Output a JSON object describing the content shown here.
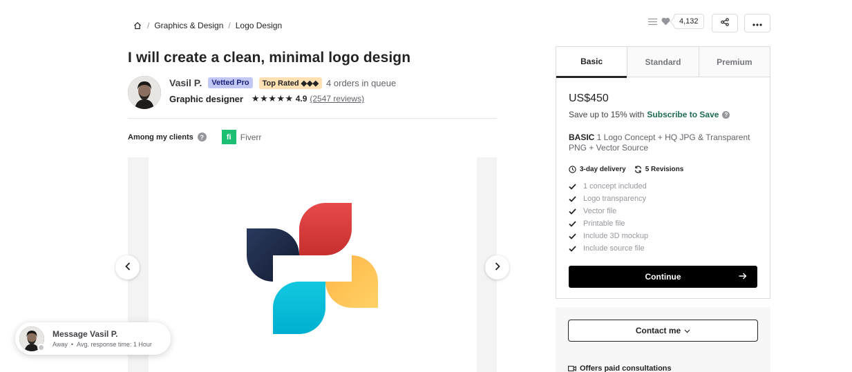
{
  "breadcrumb": {
    "items": [
      "Graphics & Design",
      "Logo Design"
    ],
    "separator": "/"
  },
  "header": {
    "likes_count": "4,132"
  },
  "gig": {
    "title": "I will create a clean, minimal logo design"
  },
  "seller": {
    "name": "Vasil P.",
    "badge_vetted": "Vetted Pro",
    "badge_top": "Top Rated ◆◆◆",
    "queue": "4 orders in queue",
    "job_title": "Graphic designer",
    "stars": "★★★★★",
    "rating": "4.9",
    "reviews": "(2547 reviews)"
  },
  "clients": {
    "label": "Among my clients",
    "client_name": "Fiverr",
    "client_logo_text": "fi"
  },
  "package": {
    "tabs": [
      "Basic",
      "Standard",
      "Premium"
    ],
    "active_tab": "Basic",
    "price": "US$450",
    "save_prefix": "Save up to 15% with",
    "save_link": "Subscribe to Save",
    "desc_title": "BASIC",
    "desc_text": " 1 Logo Concept + HQ JPG & Transparent PNG + Vector Source",
    "delivery": "3-day delivery",
    "revisions": "5 Revisions",
    "features": [
      "1 concept included",
      "Logo transparency",
      "Vector file",
      "Printable file",
      "Include 3D mockup",
      "Include source file"
    ],
    "continue_label": "Continue"
  },
  "contact": {
    "button_label": "Contact me",
    "consult": "Offers paid consultations"
  },
  "message": {
    "title": "Message Vasil P.",
    "status": "Away",
    "response": "Avg. response time: 1 Hour"
  },
  "colors": {
    "vetted_bg": "#c2c7f4",
    "top_rated_bg": "#ffe0b3",
    "brand_green": "#1dbf73",
    "subscribe_green": "#1d6b52",
    "logo_navy": "#1e2b4a",
    "logo_red": "#e53e3e",
    "logo_cyan": "#1fc7da",
    "logo_yellow": "#ffc04d"
  }
}
